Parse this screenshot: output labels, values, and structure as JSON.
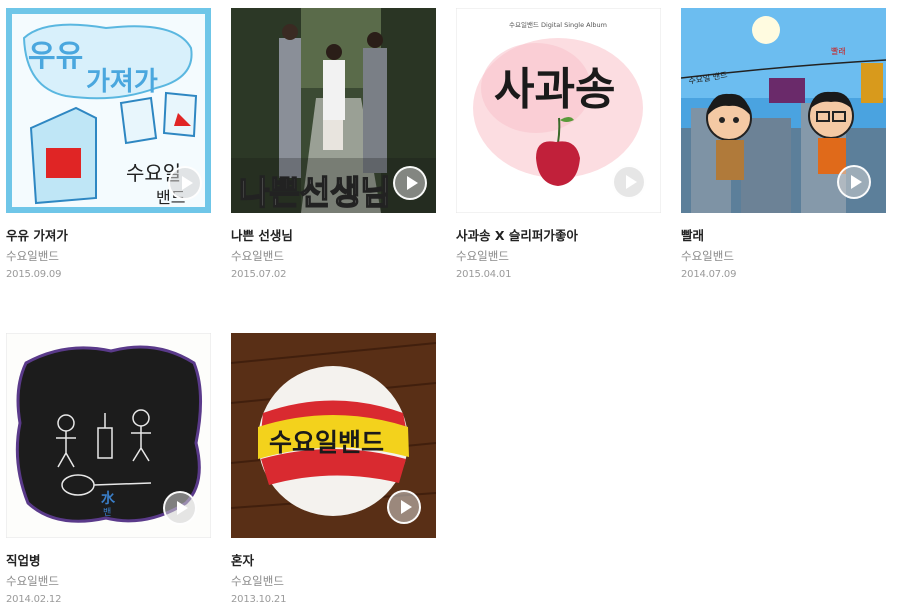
{
  "albums": [
    {
      "title": "우유 가져가",
      "artist": "수요일밴드",
      "date": "2015.09.09",
      "cover_text": [
        "우유",
        "가져가",
        "수요일",
        "밴드"
      ],
      "accent": "#6fc6e8"
    },
    {
      "title": "나쁜 선생님",
      "artist": "수요일밴드",
      "date": "2015.07.02",
      "cover_text": [
        "나쁜선생님"
      ],
      "accent": "#2f3b2a"
    },
    {
      "title": "사과송 X 슬리퍼가좋아",
      "artist": "수요일밴드",
      "date": "2015.04.01",
      "cover_text": [
        "사과송",
        "수요일밴드 Digital Single Album"
      ],
      "accent": "#c1203a"
    },
    {
      "title": "빨래",
      "artist": "수요일밴드",
      "date": "2014.07.09",
      "cover_text": [
        "수요일 밴드",
        "빨래"
      ],
      "accent": "#4aa3e0"
    },
    {
      "title": "직업병",
      "artist": "수요일밴드",
      "date": "2014.02.12",
      "cover_text": [
        "水",
        "밴"
      ],
      "accent": "#1a1a1a"
    },
    {
      "title": "혼자",
      "artist": "수요일밴드",
      "date": "2013.10.21",
      "cover_text": [
        "수요일밴드"
      ],
      "accent": "#e8343a"
    }
  ]
}
